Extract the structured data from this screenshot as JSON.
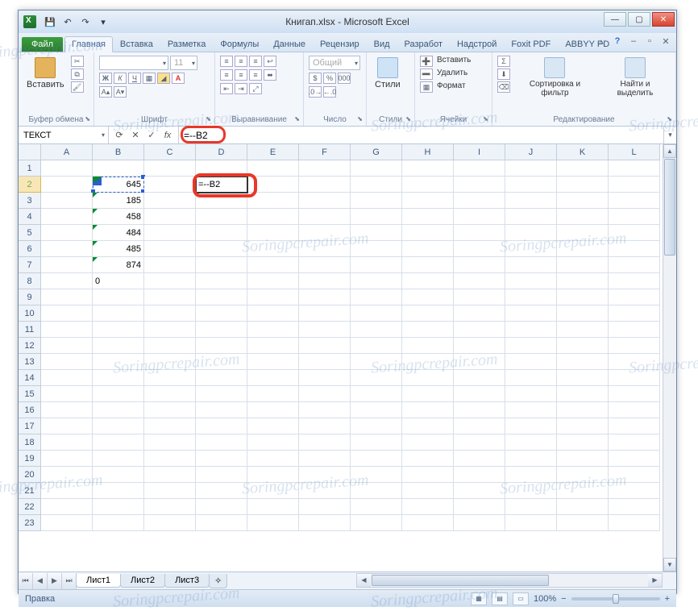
{
  "window": {
    "title": "Книгап.xlsx - Microsoft Excel"
  },
  "qat": {
    "save": "💾",
    "undo": "↶",
    "redo": "↷",
    "dd": "▾"
  },
  "tabs": {
    "file": "Файл",
    "items": [
      "Главная",
      "Вставка",
      "Разметка",
      "Формулы",
      "Данные",
      "Рецензир",
      "Вид",
      "Разработ",
      "Надстрой",
      "Foxit PDF",
      "ABBYY PD"
    ],
    "active": 0
  },
  "ribbon": {
    "clipboard": {
      "label": "Буфер обмена",
      "paste": "Вставить"
    },
    "font": {
      "label": "Шрифт",
      "family": "",
      "size": "11"
    },
    "align": {
      "label": "Выравнивание"
    },
    "number": {
      "label": "Число",
      "format": "Общий"
    },
    "styles": {
      "label": "Стили",
      "btn": "Стили"
    },
    "cells": {
      "label": "Ячейки",
      "insert": "Вставить",
      "delete": "Удалить",
      "format": "Формат"
    },
    "editing": {
      "label": "Редактирование",
      "sort": "Сортировка и фильтр",
      "find": "Найти и выделить"
    }
  },
  "formulaBar": {
    "nameBox": "ТЕКСТ",
    "cancel": "✕",
    "enter": "✓",
    "fx": "fx",
    "formula": "=--B2"
  },
  "grid": {
    "columns": [
      "A",
      "B",
      "C",
      "D",
      "E",
      "F",
      "G",
      "H",
      "I",
      "J",
      "K",
      "L"
    ],
    "rowCount": 23,
    "activeRow": 2,
    "refCell": {
      "row": 2,
      "col": "B"
    },
    "editCell": {
      "row": 2,
      "col": "D",
      "value": "=--B2"
    },
    "data": {
      "B2": "645",
      "B3": "185",
      "B4": "458",
      "B5": "484",
      "B6": "485",
      "B7": "874",
      "B8": "0"
    },
    "textCells": [
      "B2",
      "B3",
      "B4",
      "B5",
      "B6",
      "B7"
    ]
  },
  "sheets": {
    "nav": [
      "⏮",
      "◀",
      "▶",
      "⏭"
    ],
    "tabs": [
      "Лист1",
      "Лист2",
      "Лист3"
    ],
    "active": 0,
    "add": "⊕"
  },
  "status": {
    "mode": "Правка",
    "zoom": "100%",
    "minus": "−",
    "plus": "+"
  },
  "watermark": "Soringpcrepair.com"
}
